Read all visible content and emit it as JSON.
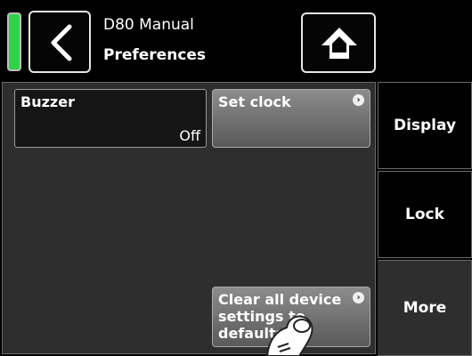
{
  "header": {
    "title": "D80 Manual",
    "subtitle": "Preferences",
    "back_icon": "chevron-left-icon",
    "home_icon": "home-icon",
    "status_color": "#2fd34a"
  },
  "main": {
    "buzzer": {
      "label": "Buzzer",
      "value": "Off"
    },
    "set_clock": {
      "label": "Set clock"
    },
    "clear_settings": {
      "label_line1": "Clear all device",
      "label_line2": "settings to",
      "label_line3": "defaults"
    }
  },
  "tabs": [
    {
      "label": "Display",
      "active": false
    },
    {
      "label": "Lock",
      "active": false
    },
    {
      "label": "More",
      "active": true
    }
  ]
}
